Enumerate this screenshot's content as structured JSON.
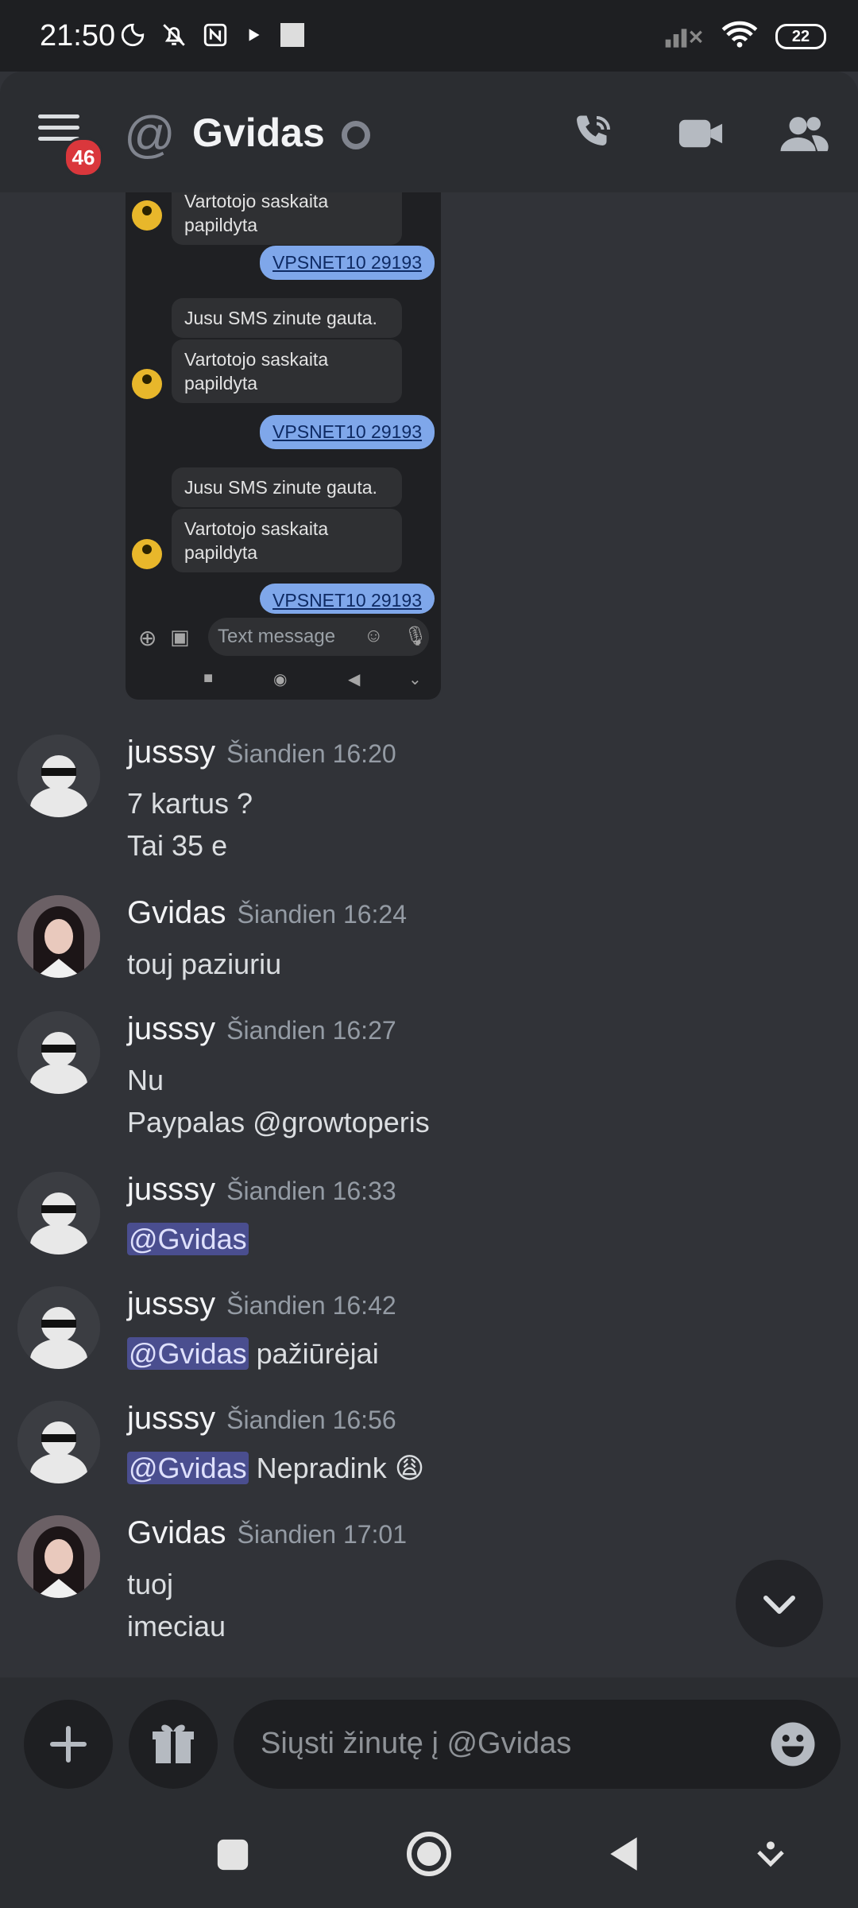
{
  "status_bar": {
    "time": "21:50",
    "battery": "22"
  },
  "header": {
    "menu_badge": "46",
    "title": "Gvidas"
  },
  "embedded_screenshot": {
    "messages": [
      {
        "type": "in",
        "text": "Vartotojo saskaita papildyta",
        "lines": [
          "Vartotojo saskaita",
          "papildyta"
        ]
      },
      {
        "type": "out",
        "text": "VPSNET10 29193"
      },
      {
        "type": "in",
        "text": "Jusu SMS zinute gauta."
      },
      {
        "type": "in",
        "text": "Vartotojo saskaita papildyta",
        "lines": [
          "Vartotojo saskaita",
          "papildyta"
        ]
      },
      {
        "type": "out",
        "text": "VPSNET10 29193"
      },
      {
        "type": "in",
        "text": "Jusu SMS zinute gauta."
      },
      {
        "type": "in",
        "text": "Vartotojo saskaita papildyta",
        "lines": [
          "Vartotojo saskaita",
          "papildyta"
        ]
      },
      {
        "type": "out",
        "text": "VPSNET10 29193"
      }
    ],
    "input_placeholder": "Text message"
  },
  "messages": [
    {
      "author": "jusssy",
      "timestamp": "Šiandien 16:20",
      "lines": [
        "7 kartus ?",
        "Tai 35 e"
      ]
    },
    {
      "author": "Gvidas",
      "timestamp": "Šiandien 16:24",
      "lines": [
        "touj paziuriu"
      ]
    },
    {
      "author": "jusssy",
      "timestamp": "Šiandien 16:27",
      "lines": [
        "Nu",
        "Paypalas @growtoperis"
      ]
    },
    {
      "author": "jusssy",
      "timestamp": "Šiandien 16:33",
      "mention": "@Gvidas",
      "text": ""
    },
    {
      "author": "jusssy",
      "timestamp": "Šiandien 16:42",
      "mention": "@Gvidas",
      "text": "pažiūrėjai"
    },
    {
      "author": "jusssy",
      "timestamp": "Šiandien 16:56",
      "mention": "@Gvidas",
      "text": "Nepradink",
      "emoji": "😩"
    },
    {
      "author": "Gvidas",
      "timestamp": "Šiandien 17:01",
      "lines": [
        "tuoj",
        "imeciau"
      ]
    }
  ],
  "composer": {
    "placeholder": "Siųsti žinutę į @Gvidas"
  },
  "icons": [
    "menu-icon",
    "at-icon",
    "phone-call-icon",
    "video-icon",
    "members-icon",
    "plus-icon",
    "gift-icon",
    "emoji-icon",
    "chevron-down-icon"
  ],
  "colors": {
    "background": "#313338",
    "header": "#2b2d31",
    "mention_bg": "#4a4e8f",
    "badge": "#da373c"
  }
}
